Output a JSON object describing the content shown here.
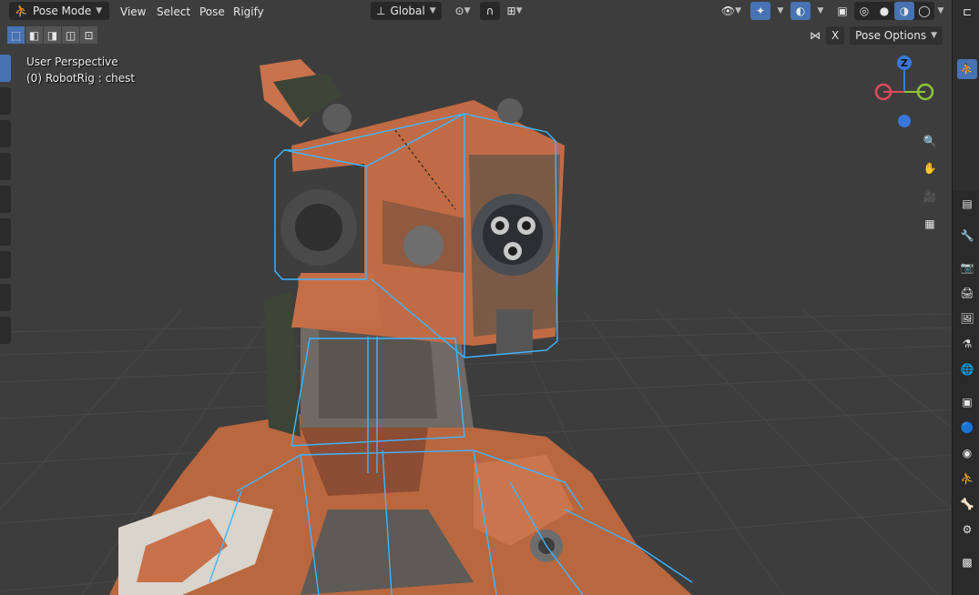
{
  "header": {
    "mode": "Pose Mode",
    "menus": [
      "View",
      "Select",
      "Pose",
      "Rigify"
    ],
    "transform_orientation": "Global"
  },
  "overlay": {
    "perspective": "User Perspective",
    "context": "(0) RobotRig : chest"
  },
  "pose_options": {
    "x_label": "X",
    "label": "Pose Options"
  },
  "gizmo": {
    "z_label": "Z"
  },
  "colors": {
    "accent": "#4772b3",
    "bone_outline": "#3fb5ff",
    "robot_orange": "#c6714b",
    "axis_x": "#e04a5a",
    "axis_y": "#8bc43a",
    "axis_z": "#3a78d8"
  }
}
